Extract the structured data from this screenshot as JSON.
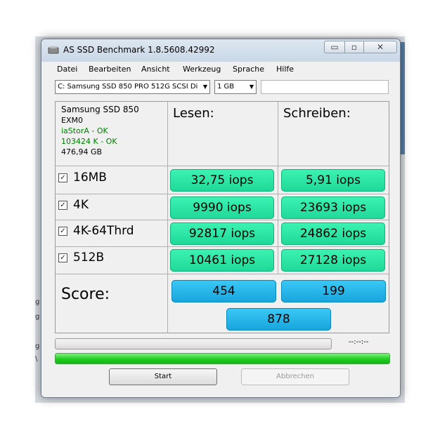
{
  "window": {
    "title": "AS SSD Benchmark 1.8.5608.42992",
    "controls": {
      "minimize": "▭",
      "maximize": "▫",
      "close": "✕"
    }
  },
  "menu": [
    "Datei",
    "Bearbeiten",
    "Ansicht",
    "Werkzeug",
    "Sprache",
    "Hilfe"
  ],
  "toolbar": {
    "drive_select": "C: Samsung SSD 850 PRO 512G SCSI Di",
    "size_select": "1 GB",
    "extra_input": ""
  },
  "drive": {
    "model": "Samsung SSD 850",
    "firmware": "EXM0",
    "driver_status": "iaStorA - OK",
    "alignment_status": "103424 K - OK",
    "capacity": "476,94 GB"
  },
  "columns": {
    "read": "Lesen:",
    "write": "Schreiben:"
  },
  "rows": [
    {
      "label": "16MB",
      "checked": true,
      "read": "32,75 iops",
      "write": "5,91 iops"
    },
    {
      "label": "4K",
      "checked": true,
      "read": "9990 iops",
      "write": "23693 iops"
    },
    {
      "label": "4K-64Thrd",
      "checked": true,
      "read": "92817 iops",
      "write": "24862 iops"
    },
    {
      "label": "512B",
      "checked": true,
      "read": "10461 iops",
      "write": "27128 iops"
    }
  ],
  "score": {
    "label": "Score:",
    "read": "454",
    "write": "199",
    "total": "878"
  },
  "progress": {
    "timer": "--:--:--",
    "overall_fraction": 1.0
  },
  "buttons": {
    "start": "Start",
    "cancel": "Abbrechen"
  },
  "colors": {
    "result_cell": "#2ee6a6",
    "score_cell": "#29b8ec",
    "progress_fill": "#22cc22"
  }
}
